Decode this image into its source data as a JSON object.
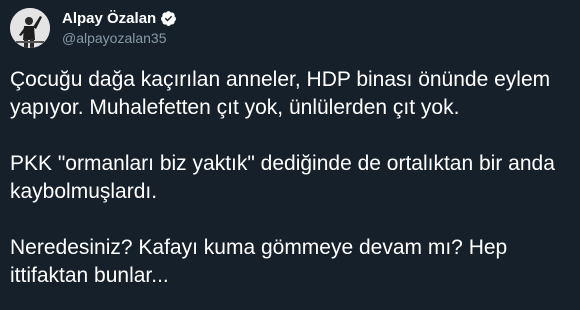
{
  "author": {
    "display_name": "Alpay Özalan",
    "handle": "@alpayozalan35",
    "verified": true,
    "verified_color": "#ffffff",
    "avatar_icon": "profile-photo"
  },
  "tweet": {
    "paragraphs": [
      "Çocuğu dağa kaçırılan anneler, HDP binası önünde eylem yapıyor. Muhalefetten çıt yok, ünlülerden çıt yok.",
      "PKK \"ormanları biz yaktık\" dediğinde de ortalıktan bir anda kaybolmuşlardı.",
      "Neredesiniz? Kafayı kuma gömmeye devam mı? Hep ittifaktan bunlar..."
    ]
  },
  "theme": {
    "background": "#15202b",
    "text": "#ffffff",
    "secondary_text": "#8899a6"
  }
}
